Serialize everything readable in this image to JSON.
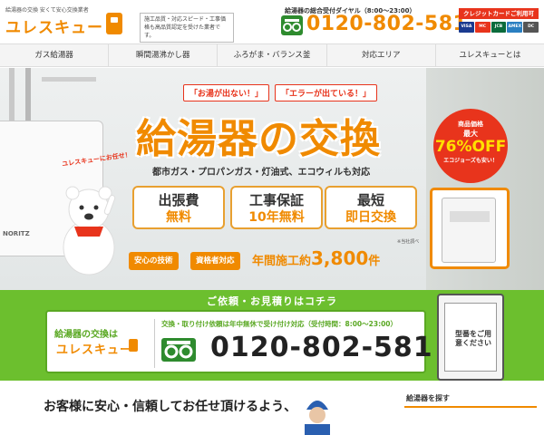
{
  "header": {
    "tagline": "給湯器の交換 安くて安心交換業者",
    "logo": "ユレスキュー",
    "note": "施工品質・対応スピード・工事価格も高品質認定を受けた業者です。",
    "dial_label": "給湯器の総合受付ダイヤル（8:00〜23:00）",
    "phone": "0120-802-581",
    "card_label": "クレジットカードご利用可",
    "cards": [
      {
        "name": "VISA",
        "color": "#1a3a8f"
      },
      {
        "name": "MC",
        "color": "#e8341c"
      },
      {
        "name": "JCB",
        "color": "#0a6b3b"
      },
      {
        "name": "AMEX",
        "color": "#2a7fc1"
      },
      {
        "name": "DC",
        "color": "#555555"
      }
    ]
  },
  "nav": {
    "items": [
      "ガス給湯器",
      "瞬間湯沸かし器",
      "ふろがま・バランス釜",
      "対応エリア",
      "ユレスキューとは"
    ]
  },
  "hero": {
    "bubble1": "「お湯が出ない！」",
    "bubble2": "「エラーが出ている！」",
    "title": "給湯器の交換",
    "subtitle": "都市ガス・プロパンガス・灯油式、エコウィルも対応",
    "features": [
      {
        "line1": "出張費",
        "line2": "無料"
      },
      {
        "line1": "工事保証",
        "line2": "10年無料"
      },
      {
        "line1": "最短",
        "line2": "即日交換"
      }
    ],
    "research": "※当社調べ",
    "pill1": "安心の技術",
    "pill2": "資格者対応",
    "annual_prefix": "年間施工約",
    "annual_number": "3,800",
    "annual_suffix": "件",
    "mascot_label": "ユレスキューにお任せ！",
    "heater_brand": "NORITZ",
    "badge": {
      "l1": "商品価格",
      "l2": "最大",
      "l3": "76%OFF",
      "l4": "エコジョーズも安い！"
    }
  },
  "contact": {
    "heading": "ご依頼・お見積りはコチラ",
    "brand_small": "給湯器の交換は",
    "brand_name": "ユレスキュー",
    "note": "交換・取り付け依頼は年中無休で受け付け対応（受付時間：8:00〜23:00）",
    "phone": "0120-802-581",
    "model_card": "型番をご用意ください"
  },
  "bottom": {
    "text": "お客様に安心・信頼してお任せ頂けるよう、",
    "sidebar_label": "給湯器を探す"
  },
  "colors": {
    "accent": "#f08a00",
    "red": "#e8341c",
    "green": "#6cbf2e"
  }
}
